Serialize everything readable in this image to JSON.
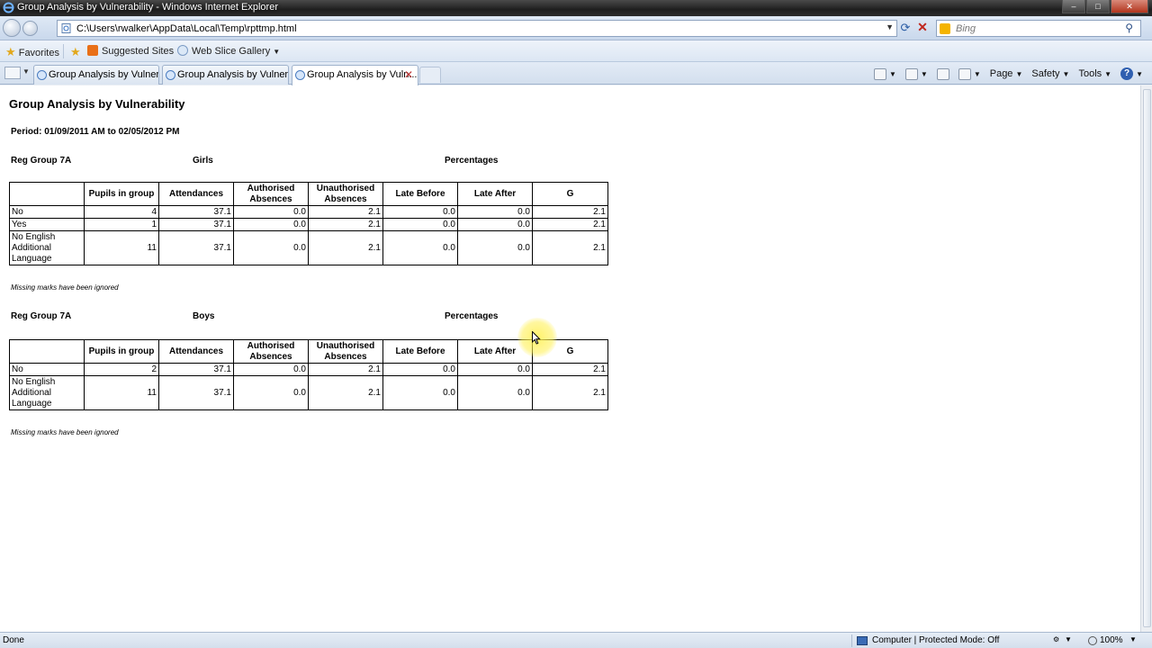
{
  "window": {
    "title": "Group Analysis by Vulnerability - Windows Internet Explorer",
    "buttons": {
      "minimize": "–",
      "maximize": "□",
      "close": "✕"
    }
  },
  "address": {
    "url": "C:\\Users\\rwalker\\AppData\\Local\\Temp\\rpttmp.html",
    "search_placeholder": "Bing"
  },
  "favorites": {
    "favorites_label": "Favorites",
    "suggested_sites": "Suggested Sites",
    "web_slice_gallery": "Web Slice Gallery"
  },
  "tabs": [
    {
      "label": "Group Analysis by Vulnera..."
    },
    {
      "label": "Group Analysis by Vulnera..."
    },
    {
      "label": "Group Analysis by Vuln..."
    }
  ],
  "commandbar": {
    "page": "Page",
    "safety": "Safety",
    "tools": "Tools",
    "help": "?"
  },
  "report": {
    "title": "Group Analysis by Vulnerability",
    "period": "Period: 01/09/2011 AM to 02/05/2012 PM",
    "headers": [
      "",
      "Pupils in group",
      "Attendances",
      "Authorised Absences",
      "Unauthorised Absences",
      "Late Before",
      "Late After",
      "G"
    ],
    "note": "Missing marks have been ignored",
    "sections": [
      {
        "group": "Reg Group 7A",
        "gender": "Girls",
        "percentages": "Percentages",
        "rows": [
          [
            "No",
            "4",
            "37.1",
            "0.0",
            "2.1",
            "0.0",
            "0.0",
            "2.1"
          ],
          [
            "Yes",
            "1",
            "37.1",
            "0.0",
            "2.1",
            "0.0",
            "0.0",
            "2.1"
          ],
          [
            "No English Additional Language",
            "11",
            "37.1",
            "0.0",
            "2.1",
            "0.0",
            "0.0",
            "2.1"
          ]
        ]
      },
      {
        "group": "Reg Group 7A",
        "gender": "Boys",
        "percentages": "Percentages",
        "rows": [
          [
            "No",
            "2",
            "37.1",
            "0.0",
            "2.1",
            "0.0",
            "0.0",
            "2.1"
          ],
          [
            "No English Additional Language",
            "11",
            "37.1",
            "0.0",
            "2.1",
            "0.0",
            "0.0",
            "2.1"
          ]
        ]
      }
    ]
  },
  "status": {
    "done": "Done",
    "zone": "Computer | Protected Mode: Off",
    "zoom": "100%"
  }
}
